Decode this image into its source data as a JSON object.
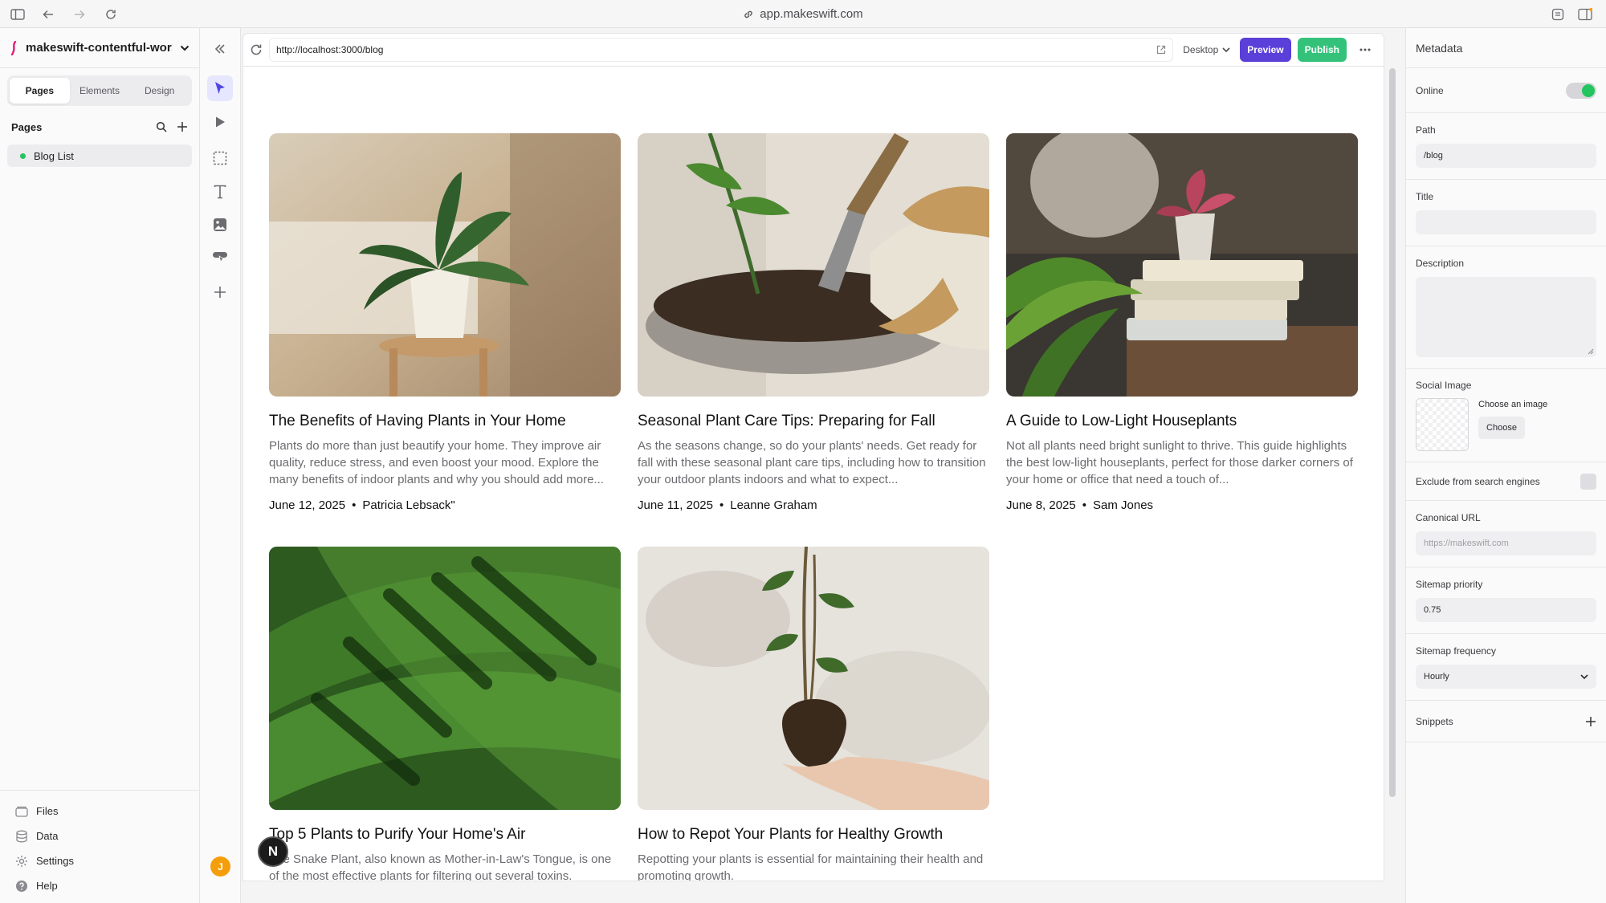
{
  "browser": {
    "address": "app.makeswift.com"
  },
  "sidebar": {
    "project_name": "makeswift-contentful-wor...",
    "tabs": [
      "Pages",
      "Elements",
      "Design"
    ],
    "pages_label": "Pages",
    "pages": [
      {
        "label": "Blog List",
        "status_color": "#22c55e"
      }
    ],
    "bottom_nav": [
      "Files",
      "Data",
      "Settings",
      "Help"
    ]
  },
  "toolrail": {
    "avatar_initial": "J"
  },
  "canvas_bar": {
    "url": "http://localhost:3000/blog",
    "device": "Desktop",
    "preview_label": "Preview",
    "publish_label": "Publish"
  },
  "posts": [
    {
      "title": "The Benefits of Having Plants in Your Home",
      "excerpt": "Plants do more than just beautify your home. They improve air quality, reduce stress, and even boost your mood. Explore the many benefits of indoor plants and why you should add more...",
      "date": "June 12, 2025",
      "author": "Patricia Lebsack\""
    },
    {
      "title": "Seasonal Plant Care Tips: Preparing for Fall",
      "excerpt": "As the seasons change, so do your plants' needs. Get ready for fall with these seasonal plant care tips, including how to transition your outdoor plants indoors and what to expect...",
      "date": "June 11, 2025",
      "author": "Leanne Graham"
    },
    {
      "title": "A Guide to Low-Light Houseplants",
      "excerpt": "Not all plants need bright sunlight to thrive. This guide highlights the best low-light houseplants, perfect for those darker corners of your home or office that need a touch of...",
      "date": "June 8, 2025",
      "author": "Sam Jones"
    },
    {
      "title": "Top 5 Plants to Purify Your Home's Air",
      "excerpt": "The Snake Plant, also known as Mother-in-Law's Tongue, is one of the most effective plants for filtering out several toxins.",
      "date": "",
      "author": ""
    },
    {
      "title": "How to Repot Your Plants for Healthy Growth",
      "excerpt": "Repotting your plants is essential for maintaining their health and promoting growth.",
      "date": "",
      "author": ""
    }
  ],
  "meta_separator": "•",
  "nextjs_badge": "N",
  "metadata": {
    "heading": "Metadata",
    "online_label": "Online",
    "online": true,
    "path_label": "Path",
    "path_value": "/blog",
    "title_label": "Title",
    "title_value": "",
    "description_label": "Description",
    "description_value": "",
    "social_image_label": "Social Image",
    "choose_image_text": "Choose an image",
    "choose_button": "Choose",
    "exclude_label": "Exclude from search engines",
    "canonical_label": "Canonical URL",
    "canonical_placeholder": "https://makeswift.com",
    "priority_label": "Sitemap priority",
    "priority_value": "0.75",
    "frequency_label": "Sitemap frequency",
    "frequency_value": "Hourly",
    "snippets_label": "Snippets"
  }
}
